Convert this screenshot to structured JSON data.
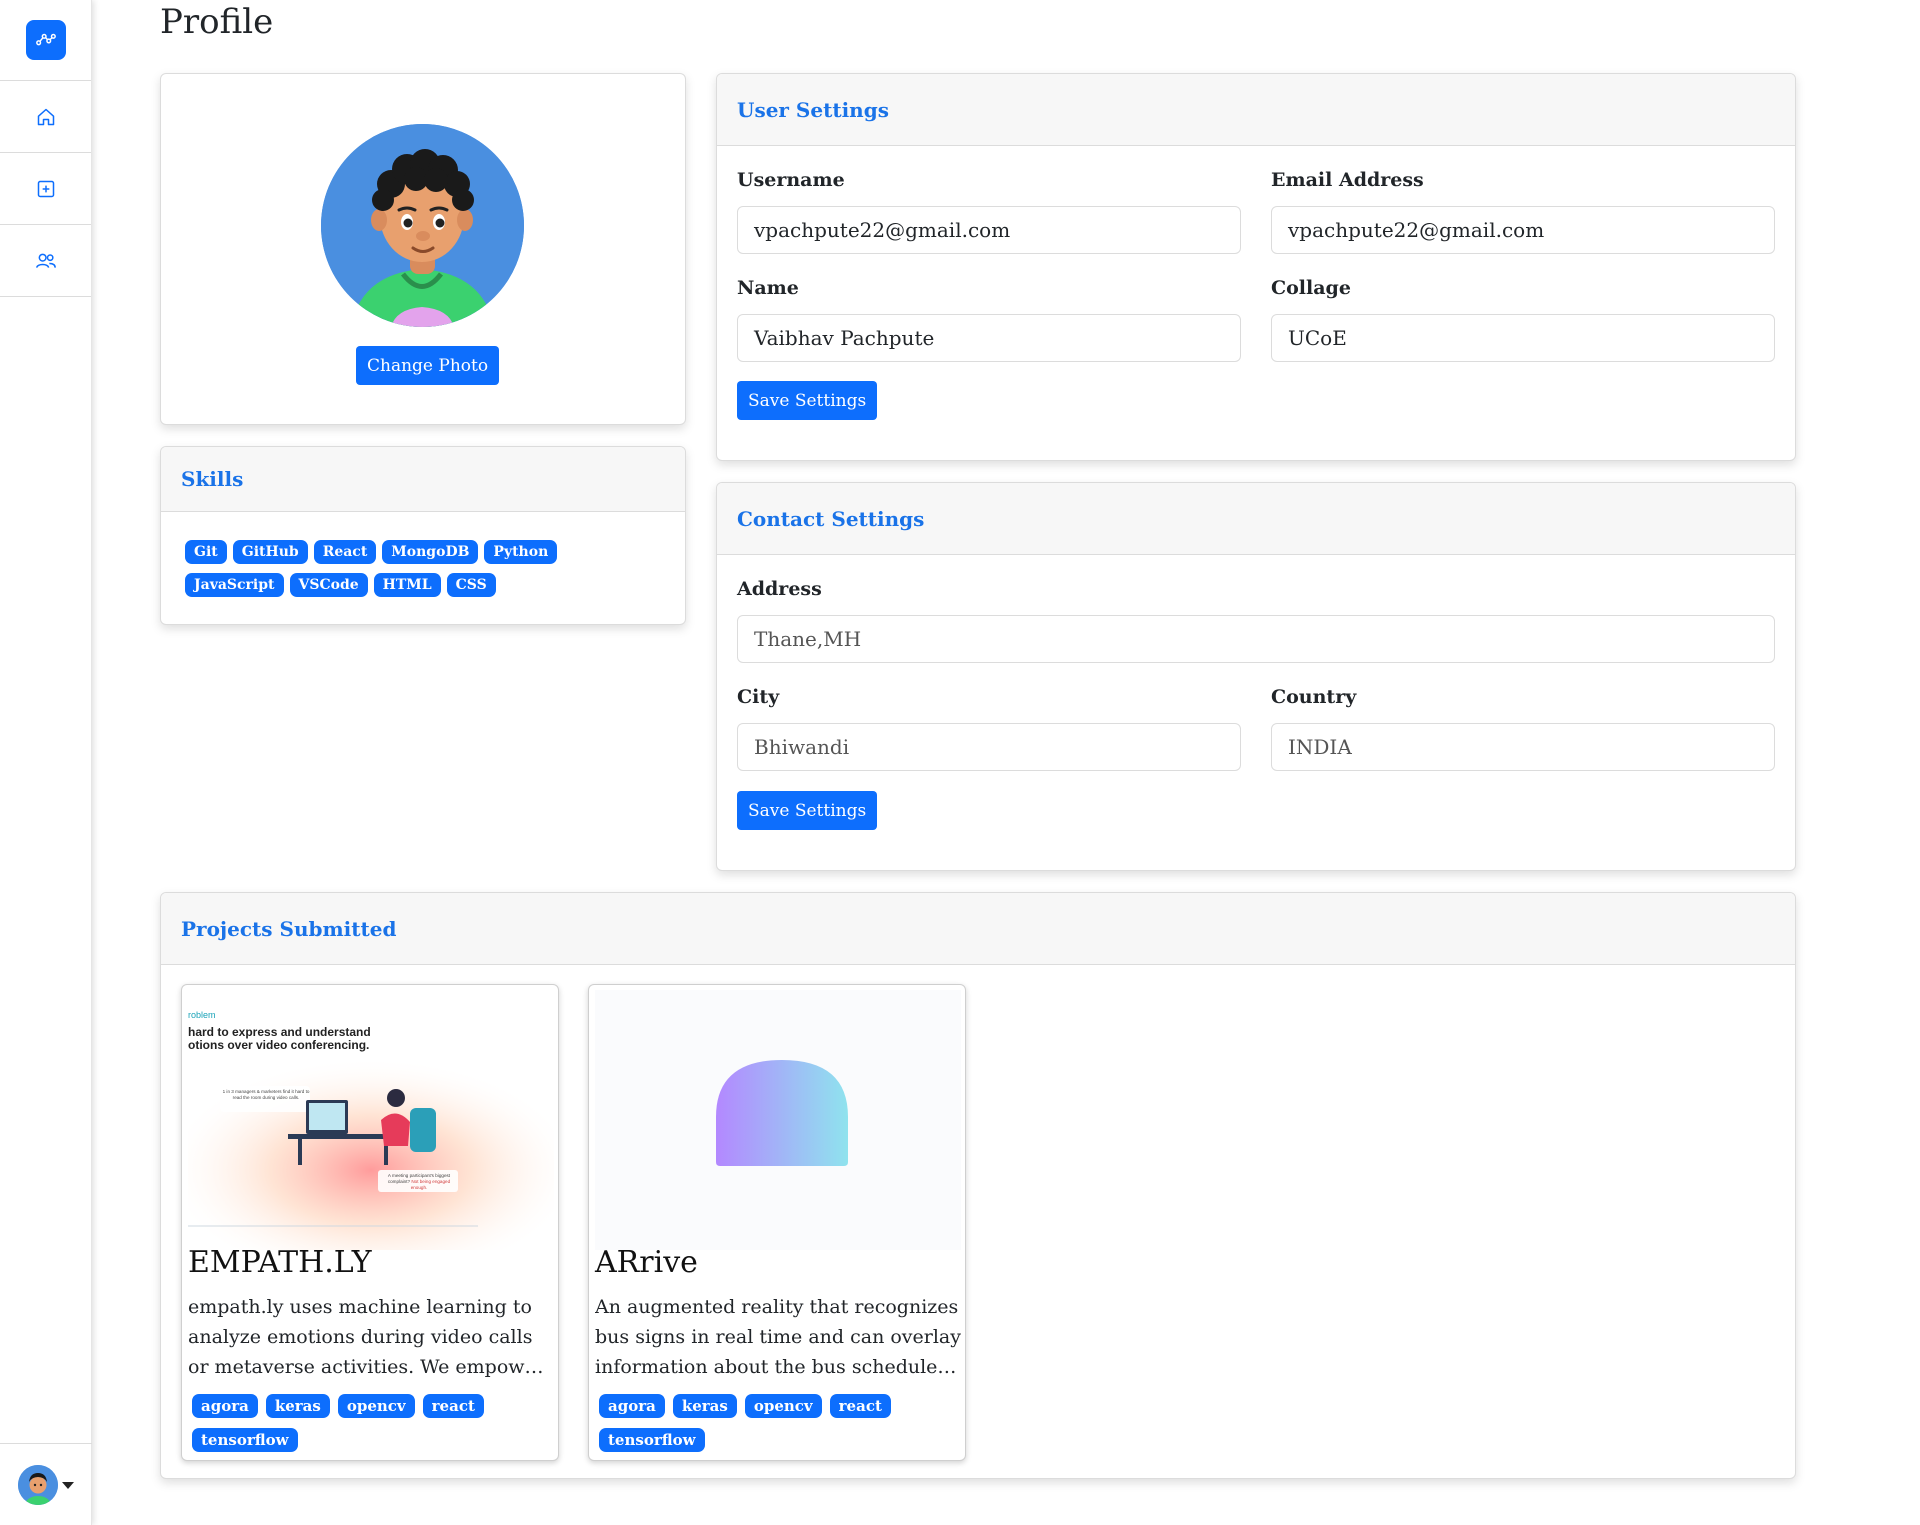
{
  "page_title": "Profile",
  "sidebar": {
    "items": [
      {
        "icon": "home-icon"
      },
      {
        "icon": "add-square-icon"
      },
      {
        "icon": "users-icon"
      }
    ]
  },
  "profile": {
    "change_photo_label": "Change Photo"
  },
  "skills": {
    "title": "Skills",
    "items": [
      "Git",
      "GitHub",
      "React",
      "MongoDB",
      "Python",
      "JavaScript",
      "VSCode",
      "HTML",
      "CSS"
    ]
  },
  "user_settings": {
    "title": "User Settings",
    "username_label": "Username",
    "username_value": "vpachpute22@gmail.com",
    "email_label": "Email Address",
    "email_value": "vpachpute22@gmail.com",
    "name_label": "Name",
    "name_value": "Vaibhav Pachpute",
    "college_label": "Collage",
    "college_value": "UCoE",
    "save_label": "Save Settings"
  },
  "contact_settings": {
    "title": "Contact Settings",
    "address_label": "Address",
    "address_value": "Thane,MH",
    "city_label": "City",
    "city_value": "Bhiwandi",
    "country_label": "Country",
    "country_value": "INDIA",
    "save_label": "Save Settings"
  },
  "projects": {
    "title": "Projects Submitted",
    "items": [
      {
        "title": "EMPATH.LY",
        "description": "empath.ly uses machine learning to analyze emotions during video calls or metaverse activities. We empower users to build stronger connections.",
        "tags": [
          "agora",
          "keras",
          "opencv",
          "react",
          "tensorflow"
        ],
        "thumb_text": {
          "kicker": "roblem",
          "line1": "hard to express and understand",
          "line2": "otions over video conferencing.",
          "callout1": "1 in 3 managers & marketers find it hard to read the room during video calls.",
          "callout2": "A meeting participant's biggest complaint?",
          "callout2_em": "Not being engaged enough."
        }
      },
      {
        "title": "ARrive",
        "description": "An augmented reality that recognizes bus signs in real time and can overlay information about the bus schedules and routes.",
        "tags": [
          "agora",
          "keras",
          "opencv",
          "react",
          "tensorflow"
        ]
      }
    ]
  },
  "colors": {
    "primary": "#0d6efd",
    "header_text": "#1a73e8"
  }
}
